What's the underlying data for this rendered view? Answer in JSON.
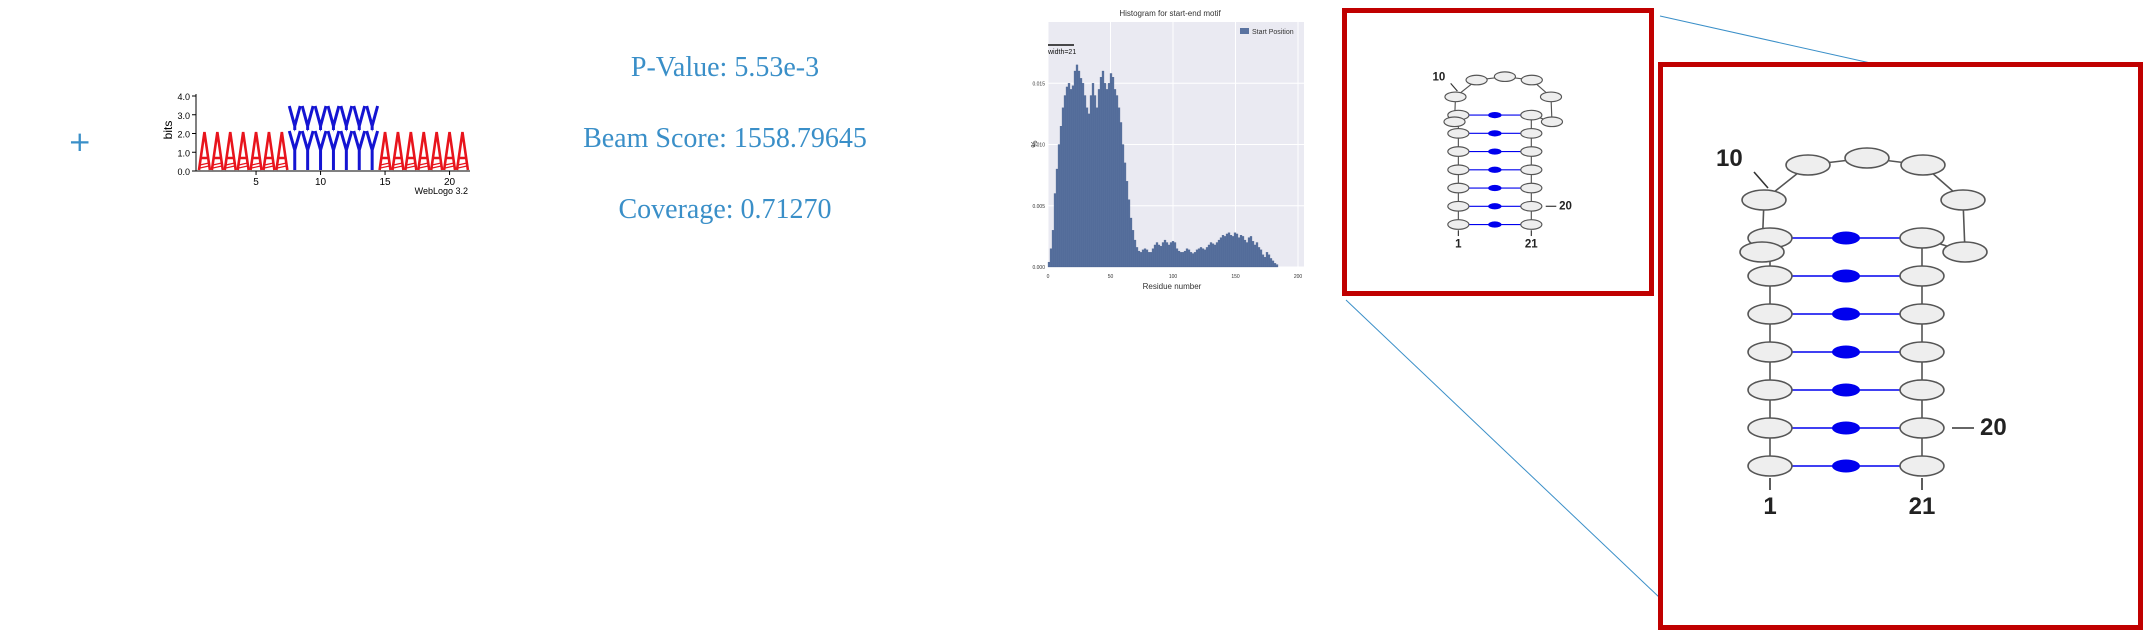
{
  "row": {
    "expand_symbol": "+",
    "logo": {
      "y_axis_label": "bits",
      "y_ticks": [
        "4.0",
        "3.0",
        "2.0",
        "1.0",
        "0.0"
      ],
      "x_ticks": [
        "5",
        "10",
        "15",
        "20"
      ],
      "attribution": "WebLogo 3.2",
      "letters": "AAAAAAAYYYYYYYAAAAAAA",
      "colors": {
        "A": "#e8141c",
        "Y": "#1414d2"
      }
    },
    "stats": {
      "p_value": "P-Value: 5.53e-3",
      "beam_score": "Beam Score: 1558.79645",
      "coverage": "Coverage: 0.71270"
    }
  },
  "chart_data": {
    "type": "bar",
    "title": "Histogram for start-end motif",
    "xlabel": "Residue number",
    "ylabel": "%",
    "legend": {
      "label": "Start Position",
      "placement": "top-right"
    },
    "annotation": "width=21",
    "xlim": [
      0,
      200
    ],
    "ylim": [
      0,
      0.02
    ],
    "x_ticks": [
      "0",
      "50",
      "100",
      "150",
      "200"
    ],
    "y_ticks": [
      "0.000",
      "0.005",
      "0.010",
      "0.015"
    ],
    "grid": true,
    "bar_color": "#5a73a0",
    "values": [
      0.0004,
      0.0015,
      0.003,
      0.006,
      0.008,
      0.01,
      0.0115,
      0.013,
      0.014,
      0.0147,
      0.015,
      0.0145,
      0.0148,
      0.016,
      0.0165,
      0.016,
      0.0154,
      0.015,
      0.014,
      0.013,
      0.0125,
      0.014,
      0.015,
      0.014,
      0.013,
      0.0145,
      0.0155,
      0.016,
      0.015,
      0.0145,
      0.015,
      0.0158,
      0.0155,
      0.0145,
      0.014,
      0.013,
      0.0118,
      0.01,
      0.0085,
      0.007,
      0.0055,
      0.004,
      0.003,
      0.0022,
      0.0016,
      0.0013,
      0.0012,
      0.0014,
      0.0015,
      0.0014,
      0.0012,
      0.0012,
      0.0015,
      0.0018,
      0.002,
      0.0018,
      0.0017,
      0.002,
      0.0022,
      0.002,
      0.0018,
      0.002,
      0.0021,
      0.002,
      0.0015,
      0.0013,
      0.0012,
      0.0012,
      0.0013,
      0.0015,
      0.0014,
      0.0012,
      0.0011,
      0.0012,
      0.0014,
      0.0015,
      0.0016,
      0.0015,
      0.0014,
      0.0016,
      0.0018,
      0.002,
      0.0019,
      0.0018,
      0.002,
      0.0022,
      0.0024,
      0.0026,
      0.0025,
      0.0027,
      0.0028,
      0.0026,
      0.0025,
      0.0028,
      0.0027,
      0.0024,
      0.0026,
      0.0025,
      0.0022,
      0.002,
      0.0024,
      0.0025,
      0.0021,
      0.0018,
      0.002,
      0.0016,
      0.0014,
      0.001,
      0.0008,
      0.0012,
      0.001,
      0.0007,
      0.0005,
      0.0003,
      0.0002
    ]
  },
  "structure": {
    "label_10": "10",
    "label_20": "20",
    "label_1": "1",
    "label_21": "21",
    "frame_color": "#c00000",
    "pair_color": "#0000ee",
    "connector_color": "#3a8fc8"
  }
}
